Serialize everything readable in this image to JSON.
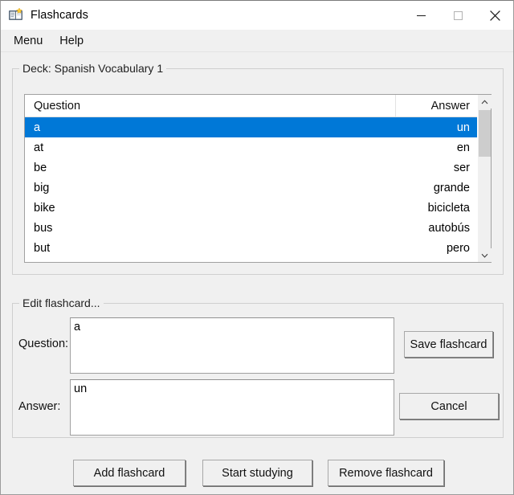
{
  "window": {
    "title": "Flashcards",
    "icon": "flashcard-book-icon",
    "controls": {
      "minimize": "minimize-icon",
      "maximize": "maximize-icon",
      "close": "close-icon"
    }
  },
  "menubar": {
    "items": [
      {
        "label": "Menu"
      },
      {
        "label": "Help"
      }
    ]
  },
  "deck_group": {
    "title": "Deck: Spanish Vocabulary 1",
    "table": {
      "columns": [
        "Question",
        "Answer"
      ],
      "rows": [
        {
          "question": "a",
          "answer": "un",
          "selected": true
        },
        {
          "question": "at",
          "answer": "en",
          "selected": false
        },
        {
          "question": "be",
          "answer": "ser",
          "selected": false
        },
        {
          "question": "big",
          "answer": "grande",
          "selected": false
        },
        {
          "question": "bike",
          "answer": "bicicleta",
          "selected": false
        },
        {
          "question": "bus",
          "answer": "autobús",
          "selected": false
        },
        {
          "question": "but",
          "answer": "pero",
          "selected": false
        }
      ],
      "scrollbar": {
        "up_arrow": "chevron-up-icon",
        "down_arrow": "chevron-down-icon"
      }
    }
  },
  "edit_group": {
    "title": "Edit flashcard...",
    "question_label": "Question:",
    "question_value": "a",
    "question_placeholder": "",
    "answer_label": "Answer:",
    "answer_value": "un",
    "answer_placeholder": "",
    "save_label": "Save flashcard",
    "cancel_label": "Cancel"
  },
  "bottom_buttons": {
    "add_label": "Add flashcard",
    "study_label": "Start studying",
    "remove_label": "Remove flashcard"
  },
  "colors": {
    "selection": "#0078d7",
    "window_bg": "#f0f0f0",
    "field_bg": "#ffffff"
  }
}
